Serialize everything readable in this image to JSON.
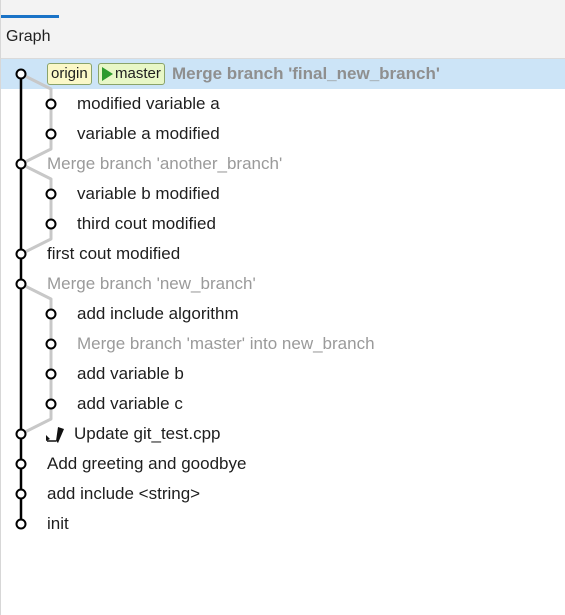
{
  "header": {
    "tab_label": "Graph"
  },
  "colors": {
    "accent": "#1a73c7",
    "selected_row": "#cce4f7",
    "main_line": "#000000",
    "branch_line": "#c8c8c8",
    "muted_text": "#9a9a9a",
    "origin_tag_bg": "#fbf8c8",
    "master_tag_bg": "#e8f7c7",
    "master_arrow": "#2e9a2e"
  },
  "refs": {
    "origin": "origin",
    "master": "master"
  },
  "commits": [
    {
      "message": "Merge branch 'final_new_branch'",
      "lane": 0,
      "style": "bold",
      "selected": true
    },
    {
      "message": "modified variable a",
      "lane": 1,
      "style": "normal"
    },
    {
      "message": "variable a modified",
      "lane": 1,
      "style": "normal"
    },
    {
      "message": "Merge branch 'another_branch'",
      "lane": 0,
      "style": "muted"
    },
    {
      "message": "variable b modified",
      "lane": 1,
      "style": "normal"
    },
    {
      "message": "third cout modified",
      "lane": 1,
      "style": "normal"
    },
    {
      "message": "first cout modified",
      "lane": 0,
      "style": "normal"
    },
    {
      "message": "Merge branch 'new_branch'",
      "lane": 0,
      "style": "muted"
    },
    {
      "message": "add include algorithm",
      "lane": 1,
      "style": "normal"
    },
    {
      "message": "Merge branch 'master' into new_branch",
      "lane": 1,
      "style": "muted"
    },
    {
      "message": "add variable b",
      "lane": 1,
      "style": "normal"
    },
    {
      "message": "add variable c",
      "lane": 1,
      "style": "normal"
    },
    {
      "message": "Update git_test.cpp",
      "lane": 0,
      "style": "normal",
      "icon": "edit-pen-icon"
    },
    {
      "message": "Add greeting and goodbye",
      "lane": 0,
      "style": "normal"
    },
    {
      "message": "add include <string>",
      "lane": 0,
      "style": "normal"
    },
    {
      "message": "init",
      "lane": 0,
      "style": "normal"
    }
  ]
}
